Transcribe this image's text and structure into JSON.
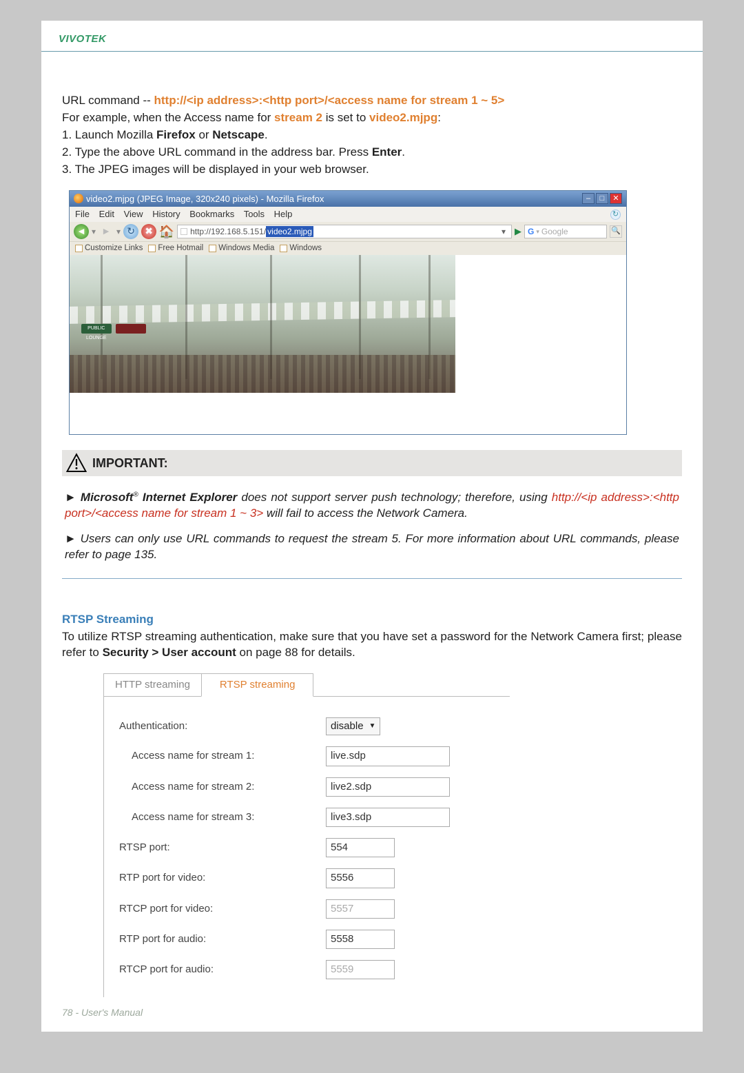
{
  "header": {
    "brand": "VIVOTEK"
  },
  "intro": {
    "prefix": "URL command -- ",
    "url_pattern": "http://<ip address>:<http port>/<access name for stream 1 ~ 5>",
    "example_line_pre": "For example, when the Access name for ",
    "example_stream": "stream 2",
    "example_line_mid": " is set to ",
    "example_name": "video2.mjpg",
    "example_line_post": ":",
    "step1_pre": "1. Launch Mozilla ",
    "step1_b1": "Firefox",
    "step1_or": " or ",
    "step1_b2": "Netscape",
    "step1_post": ".",
    "step2_pre": "2. Type the above URL command in the address bar. Press ",
    "step2_b": "Enter",
    "step2_post": ".",
    "step3": "3. The JPEG images will be displayed in your web browser."
  },
  "fx": {
    "title": "video2.mjpg (JPEG Image, 320x240 pixels) - Mozilla Firefox",
    "menu": [
      "File",
      "Edit",
      "View",
      "History",
      "Bookmarks",
      "Tools",
      "Help"
    ],
    "addr_prefix": "http://192.168.5.151/",
    "addr_selected": "video2.mjpg",
    "search_placeholder": "Google",
    "bookmarks": [
      "Customize Links",
      "Free Hotmail",
      "Windows Media",
      "Windows"
    ],
    "sign1": "PUBLIC LOUNGE",
    "sign2": ""
  },
  "important": {
    "title": "IMPORTANT:",
    "p1_pre": "► ",
    "p1_ms": "Microsoft",
    "p1_reg": "®",
    "p1_ie": " Internet Explorer",
    "p1_mid": " does not support server push technology; therefore, using ",
    "p1_url": "http://<ip address>:<http port>/<access name for stream 1 ~ 3>",
    "p1_post": " will fail to access the Network Camera.",
    "p2": "► Users can only use URL commands to request the stream 5. For more information about URL commands, please refer to page 135."
  },
  "rtsp": {
    "heading": "RTSP Streaming",
    "desc_pre": "To utilize RTSP streaming authentication, make sure that you have set a password for the Network Camera first; please refer to ",
    "desc_bold": "Security > User account",
    "desc_post": " on page 88 for details.",
    "tabs": {
      "http": "HTTP streaming",
      "rtsp": "RTSP streaming"
    },
    "labels": {
      "auth": "Authentication:",
      "s1": "Access name for stream 1:",
      "s2": "Access name for stream 2:",
      "s3": "Access name for stream 3:",
      "rtsp_port": "RTSP port:",
      "rtp_v": "RTP port for video:",
      "rtcp_v": "RTCP port for video:",
      "rtp_a": "RTP port for audio:",
      "rtcp_a": "RTCP port for audio:"
    },
    "values": {
      "auth": "disable",
      "s1": "live.sdp",
      "s2": "live2.sdp",
      "s3": "live3.sdp",
      "rtsp_port": "554",
      "rtp_v": "5556",
      "rtcp_v": "5557",
      "rtp_a": "5558",
      "rtcp_a": "5559"
    }
  },
  "footer": {
    "text": "78 - User's Manual"
  }
}
